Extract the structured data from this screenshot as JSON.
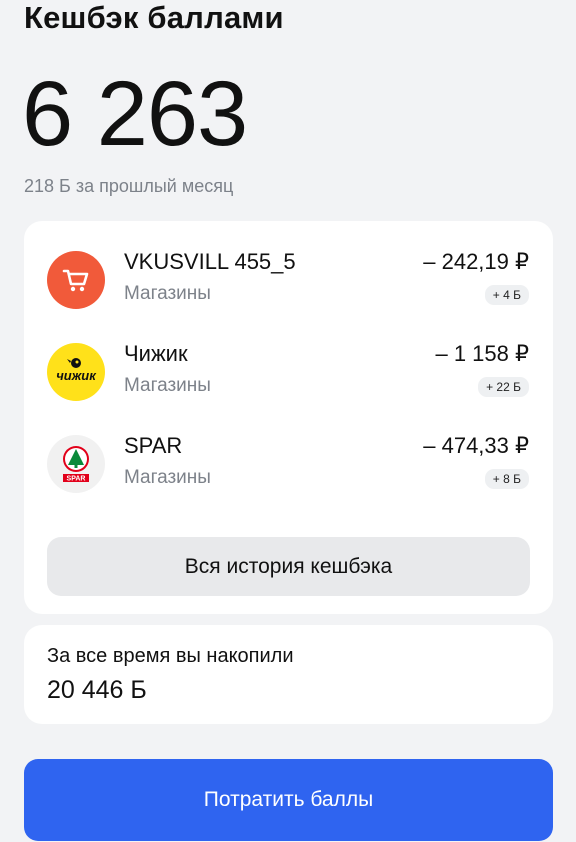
{
  "header": {
    "title": "Кешбэк баллами",
    "balance": "6 263",
    "last_month": "218 Б за прошлый месяц"
  },
  "transactions": [
    {
      "name": "VKUSVILL 455_5",
      "category": "Магазины",
      "amount": "– 242,19 ₽",
      "cashback": "+ 4 Б",
      "icon": "shopping-cart-icon",
      "icon_bg": "#f15a3a"
    },
    {
      "name": "Чижик",
      "category": "Магазины",
      "amount": "– 1 158 ₽",
      "cashback": "+ 22 Б",
      "icon": "chizhik-logo",
      "logo_text": "чижик",
      "icon_bg": "#ffe11a"
    },
    {
      "name": "SPAR",
      "category": "Магазины",
      "amount": "– 474,33 ₽",
      "cashback": "+ 8 Б",
      "icon": "spar-logo",
      "logo_text": "SPAR",
      "icon_bg": "#f1f1f1"
    }
  ],
  "history_button": "Вся история кешбэка",
  "total": {
    "label": "За все время вы накопили",
    "value": "20 446 Б"
  },
  "spend_button": "Потратить баллы",
  "colors": {
    "accent": "#2f64f0",
    "background": "#f2f3f5",
    "card": "#ffffff",
    "muted_text": "#7d828a"
  }
}
